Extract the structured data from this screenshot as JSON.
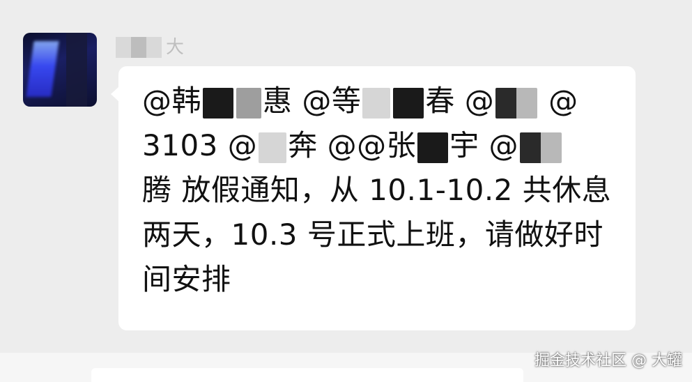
{
  "chat": {
    "sender": {
      "avatar_alt": "avatar",
      "name_suffix": "大"
    },
    "message": {
      "line1": [
        "@韩",
        "惠",
        "@等",
        "春",
        "@",
        "@"
      ],
      "line2": [
        "3103",
        "@",
        "奔",
        "@@张",
        "宇",
        "@"
      ],
      "line3": "腾  放假通知，从 10.1-10.2 共休息",
      "line4": "两天，10.3 号正式上班，请做好时",
      "line5": "间安排"
    }
  },
  "watermark": "掘金技术社区 @ 大罐"
}
